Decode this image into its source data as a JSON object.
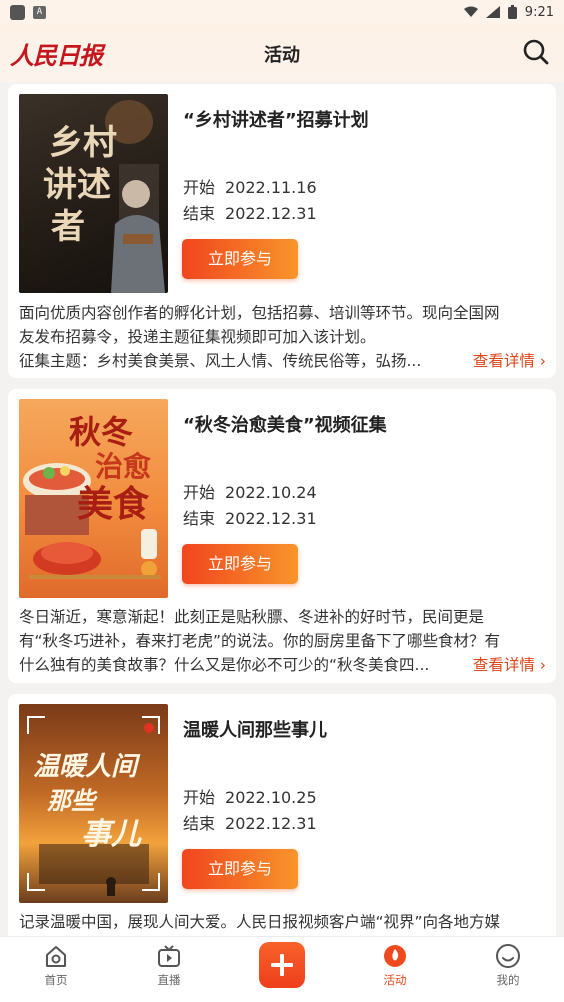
{
  "status_bar": {
    "time": "9:21",
    "a_badge": "A"
  },
  "header": {
    "logo": "人民日报",
    "title": "活动"
  },
  "cards": [
    {
      "title": "“乡村讲述者”招募计划",
      "start_label": "开始",
      "start_date": "2022.11.16",
      "end_label": "结束",
      "end_date": "2022.12.31",
      "button": "立即参与",
      "desc_1": "面向优质内容创作者的孵化计划，包括招募、培训等环节。现向全国网",
      "desc_2": "友发布招募令，投递主题征集视频即可加入该计划。",
      "desc_3": "征集主题：乡村美食美景、风土人情、传统民俗等，弘扬...",
      "more": "查看详情 ›",
      "thumb_text_1": "乡村",
      "thumb_text_2": "讲述",
      "thumb_text_3": "者"
    },
    {
      "title": "“秋冬治愈美食”视频征集",
      "start_label": "开始",
      "start_date": "2022.10.24",
      "end_label": "结束",
      "end_date": "2022.12.31",
      "button": "立即参与",
      "desc_1": "冬日渐近，寒意渐起！此刻正是贴秋膘、冬进补的好时节，民间更是",
      "desc_2": "有“秋冬巧进补，春来打老虎”的说法。你的厨房里备下了哪些食材？有",
      "desc_3": "什么独有的美食故事？什么又是你必不可少的“秋冬美食四...",
      "more": "查看详情 ›",
      "thumb_text_1": "秋冬",
      "thumb_text_2": "治愈",
      "thumb_text_3": "美食"
    },
    {
      "title": "温暖人间那些事儿",
      "start_label": "开始",
      "start_date": "2022.10.25",
      "end_label": "结束",
      "end_date": "2022.12.31",
      "button": "立即参与",
      "desc_1": "记录温暖中国，展现人间大爱。人民日报视频客户端“视界”向各地方媒",
      "thumb_text_1": "温暖人间",
      "thumb_text_2": "那些",
      "thumb_text_3": "事儿"
    }
  ],
  "tabbar": {
    "home": "首页",
    "live": "直播",
    "activity": "活动",
    "mine": "我的"
  },
  "colors": {
    "accent": "#e1481b",
    "button_start": "#f1451e",
    "button_end": "#f8952b"
  }
}
